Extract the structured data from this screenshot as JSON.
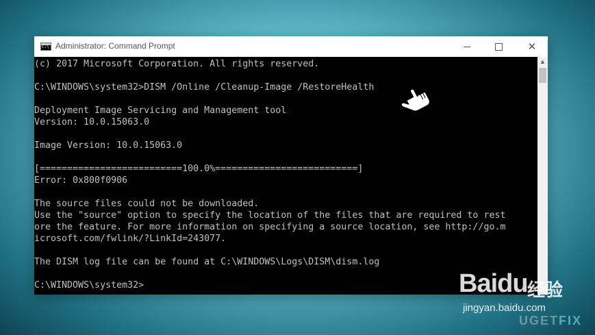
{
  "window": {
    "title": "Administrator: Command Prompt",
    "icon": "cmd-icon",
    "controls": {
      "minimize_icon": "minimize-icon",
      "maximize_icon": "maximize-icon",
      "close_icon": "close-icon",
      "close_glyph": "✕"
    }
  },
  "console": {
    "lines": [
      "(c) 2017 Microsoft Corporation. All rights reserved.",
      "",
      "C:\\WINDOWS\\system32>DISM /Online /Cleanup-Image /RestoreHealth",
      "",
      "Deployment Image Servicing and Management tool",
      "Version: 10.0.15063.0",
      "",
      "Image Version: 10.0.15063.0",
      "",
      "[==========================100.0%==========================]",
      "Error: 0x800f0906",
      "",
      "The source files could not be downloaded.",
      "Use the \"source\" option to specify the location of the files that are required to rest",
      "ore the feature. For more information on specifying a source location, see http://go.m",
      "icrosoft.com/fwlink/?LinkId=243077.",
      "",
      "The DISM log file can be found at C:\\WINDOWS\\Logs\\DISM\\dism.log",
      "",
      "C:\\WINDOWS\\system32>"
    ]
  },
  "watermarks": {
    "baidu_logo": "Bai",
    "baidu_logo_paw": "du",
    "baidu_cn": "经验",
    "baidu_url": "jingyan.baidu.com",
    "ugetfix_a": "UG",
    "ugetfix_b": "ET",
    "ugetfix_c": "FIX"
  },
  "colors": {
    "console_bg": "#000000",
    "console_fg": "#c0c0c0",
    "titlebar_bg": "#ffffff"
  }
}
